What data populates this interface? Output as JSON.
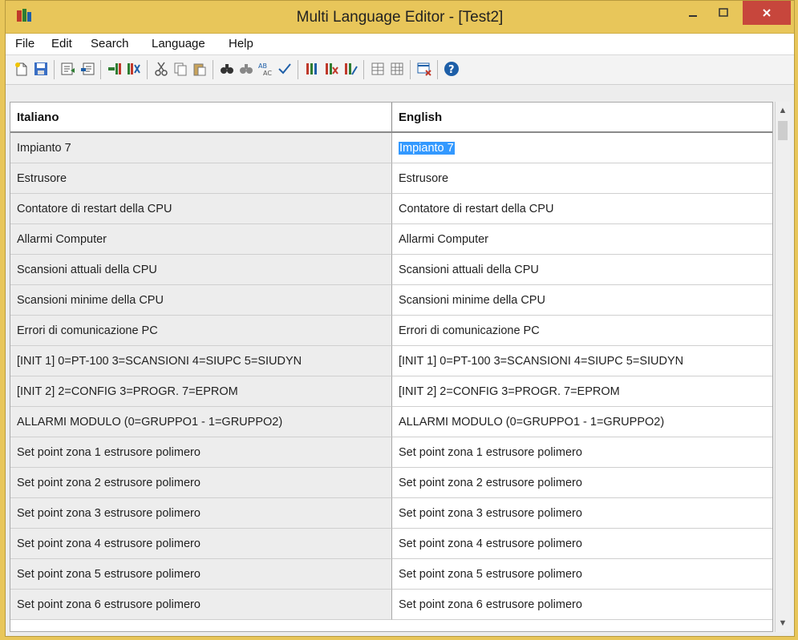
{
  "window": {
    "title": "Multi Language Editor - [Test2]"
  },
  "menu": [
    "File",
    "Edit",
    "Search",
    "Language",
    "Help"
  ],
  "columns": {
    "italiano": "Italiano",
    "english": "English"
  },
  "rows": [
    {
      "it": "Impianto 7",
      "en": "Impianto 7"
    },
    {
      "it": "Estrusore",
      "en": "Estrusore"
    },
    {
      "it": "Contatore di restart della CPU",
      "en": "Contatore di restart della CPU"
    },
    {
      "it": "Allarmi Computer",
      "en": "Allarmi Computer"
    },
    {
      "it": "Scansioni attuali della CPU",
      "en": "Scansioni attuali della CPU"
    },
    {
      "it": "Scansioni minime della CPU",
      "en": "Scansioni minime della CPU"
    },
    {
      "it": "Errori di comunicazione PC",
      "en": "Errori di comunicazione PC"
    },
    {
      "it": "[INIT 1] 0=PT-100 3=SCANSIONI 4=SIUPC 5=SIUDYN",
      "en": "[INIT 1] 0=PT-100 3=SCANSIONI 4=SIUPC 5=SIUDYN"
    },
    {
      "it": "[INIT 2] 2=CONFIG 3=PROGR. 7=EPROM",
      "en": "[INIT 2] 2=CONFIG 3=PROGR. 7=EPROM"
    },
    {
      "it": "ALLARMI MODULO  (0=GRUPPO1 - 1=GRUPPO2)",
      "en": "ALLARMI MODULO  (0=GRUPPO1 - 1=GRUPPO2)"
    },
    {
      "it": "Set point zona 1 estrusore polimero",
      "en": "Set point zona 1 estrusore polimero"
    },
    {
      "it": "Set point zona 2 estrusore polimero",
      "en": "Set point zona 2 estrusore polimero"
    },
    {
      "it": "Set point zona 3 estrusore polimero",
      "en": "Set point zona 3 estrusore polimero"
    },
    {
      "it": "Set point zona 4 estrusore polimero",
      "en": "Set point zona 4 estrusore polimero"
    },
    {
      "it": "Set point zona 5 estrusore polimero",
      "en": "Set point zona 5 estrusore polimero"
    },
    {
      "it": "Set point zona 6 estrusore polimero",
      "en": "Set point zona 6 estrusore polimero"
    }
  ],
  "colors": {
    "titlebar": "#e8c65a",
    "close": "#c7463c",
    "selection": "#3399ff"
  },
  "toolbar_icons": [
    "new-icon",
    "save-icon",
    "export-icon",
    "import-icon",
    "add-column-icon",
    "remove-column-icon",
    "cut-icon",
    "copy-icon",
    "paste-icon",
    "find-icon",
    "find-next-icon",
    "replace-icon",
    "spellcheck-icon",
    "language-add-icon",
    "language-delete-icon",
    "language-edit-icon",
    "grid-icon",
    "grid-alt-icon",
    "clear-icon",
    "help-icon"
  ]
}
